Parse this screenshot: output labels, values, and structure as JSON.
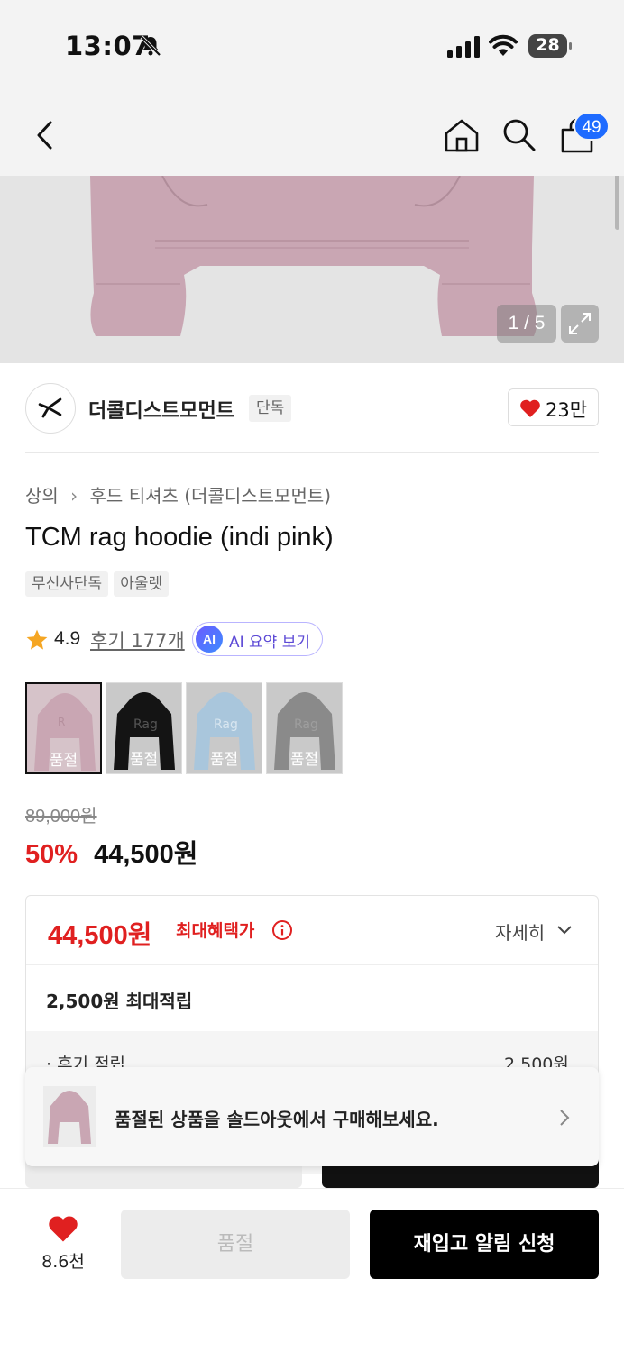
{
  "status_bar": {
    "time": "13:07",
    "battery": "28"
  },
  "header": {
    "cart_badge": "49"
  },
  "gallery": {
    "counter": "1 / 5"
  },
  "brand": {
    "name": "더콜디스트모먼트",
    "exclusive_tag": "단독",
    "likes": "23만"
  },
  "breadcrumb": {
    "category": "상의",
    "subcategory": "후드 티셔츠 (더콜디스트모먼트)"
  },
  "product": {
    "title": "TCM rag hoodie (indi pink)",
    "tags": [
      "무신사단독",
      "아울렛"
    ],
    "rating": "4.9",
    "reviews": "후기 177개",
    "ai_badge": "AI",
    "ai_label": "AI 요약 보기"
  },
  "swatches": [
    {
      "label": "품절",
      "color": "#c9a6b3"
    },
    {
      "label": "품절",
      "color": "#141414"
    },
    {
      "label": "품절",
      "color": "#a9c6dc"
    },
    {
      "label": "품절",
      "color": "#8a8a8a"
    }
  ],
  "price": {
    "original": "89,000원",
    "discount": "50%",
    "sale": "44,500원"
  },
  "benefit": {
    "best_price": "44,500원",
    "best_label": "최대혜택가",
    "detail": "자세히",
    "points": "2,500원 최대적립",
    "review_points_label": "· 후기 적립",
    "review_points_value": "2,500원"
  },
  "toast": {
    "message": "품절된 상품을 솔드아웃에서 구매해보세요."
  },
  "bottom": {
    "wish_count": "8.6천",
    "soldout_label": "품절",
    "restock_label": "재입고 알림 신청"
  },
  "colors": {
    "accent_red": "#e02020",
    "badge_blue": "#1e6bff",
    "hoodie_pink": "#c9a6b3"
  }
}
